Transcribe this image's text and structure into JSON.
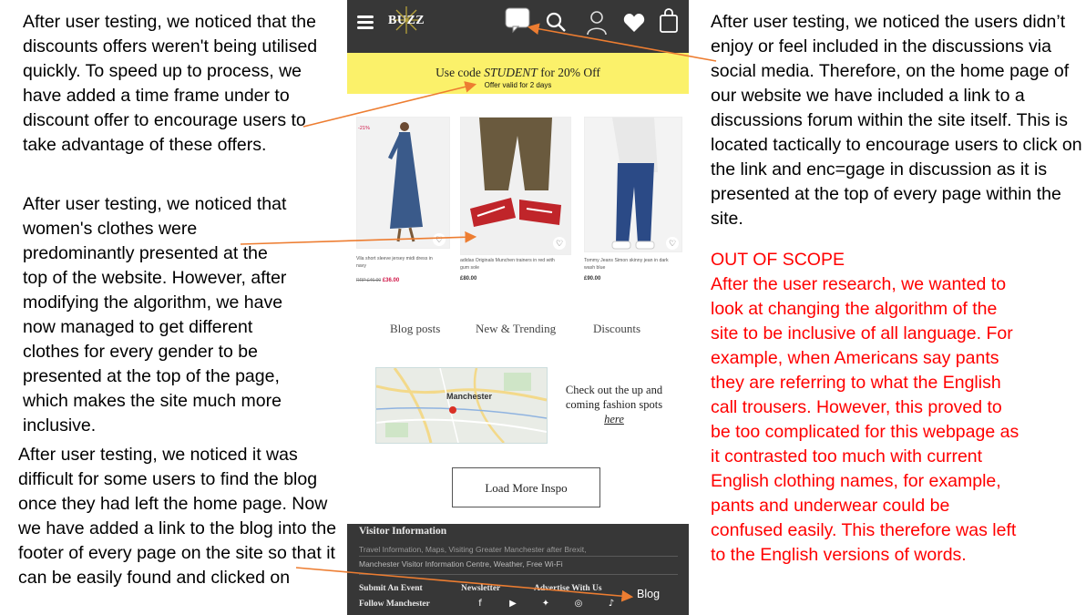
{
  "annotations": {
    "discount_note": "After user testing, we noticed that the discounts offers weren't being utilised quickly. To speed up to process, we have added a time frame under to discount offer to encourage users to take advantage of these offers.",
    "clothes_note": "After user testing, we noticed that women's clothes were predominantly presented at the top of the website. However, after modifying the algorithm, we have now managed to get different clothes for every gender to be presented at the top of the page, which makes the site much more inclusive.",
    "blog_note": "After user testing, we noticed it was difficult for some users to find the blog once they had left the home page. Now we have added a link to the blog into the footer of every page on the site so that it can be easily found and clicked on",
    "discussion_note": "After user testing, we noticed the users didn’t enjoy or feel included in the discussions via social media. Therefore, on the home page of our website we have included a link to a discussions forum within the site itself. This is located tactically to encourage users to click on the link and enc=gage in discussion as it is presented at the top of every page within the site.",
    "scope_title": "OUT OF SCOPE",
    "scope_body": "After the user research, we wanted to look at changing the algorithm of the site to be inclusive of all language. For example, when Americans say pants they are referring to what the English call trousers. However, this proved to be too complicated for this webpage as it contrasted too much with current English clothing names, for example, pants and underwear could be confused easily. This therefore was left to the English versions of words."
  },
  "header": {
    "logo": "BUZZ",
    "icons": [
      "menu-icon",
      "chat-bubble-icon",
      "search-icon",
      "user-icon",
      "heart-icon",
      "shopping-bag-icon"
    ]
  },
  "promo": {
    "code_prefix": "Use code ",
    "code": "STUDENT",
    "code_suffix": " for 20% Off",
    "validity": "Offer valid for 2 days"
  },
  "products": [
    {
      "badge": "-21%",
      "name": "Vila short sleeve jersey midi dress in navy",
      "old_price": "RRP £46.00",
      "price": "£36.00"
    },
    {
      "name": "adidas Originals Munchen trainers in red with gum sole",
      "price": "£80.00"
    },
    {
      "name": "Tommy Jeans Simon skinny jean in dark wash blue",
      "price": "£90.00"
    }
  ],
  "tabs": [
    "Blog posts",
    "New & Trending",
    "Discounts"
  ],
  "map": {
    "city": "Manchester"
  },
  "check": {
    "text": "Check out the up and coming fashion spots",
    "link": "here"
  },
  "load_more": "Load More Inspo",
  "footer": {
    "title": "Visitor Information",
    "line1": "Travel Information, Maps, Visiting Greater Manchester after Brexit,",
    "line2": "Manchester Visitor Information Centre, Weather, Free Wi-Fi",
    "links": [
      "Submit An Event",
      "Newsletter",
      "Advertise With Us",
      "Follow Manchester"
    ],
    "blog": "Blog",
    "social": [
      "facebook-icon",
      "youtube-icon",
      "twitter-icon",
      "instagram-icon",
      "tiktok-icon"
    ]
  },
  "colors": {
    "header_bg": "#373737",
    "promo_bg": "#fbf16a",
    "arrow": "#ed7d31",
    "scope_text": "#ff0000",
    "sale_price": "#d01345"
  }
}
